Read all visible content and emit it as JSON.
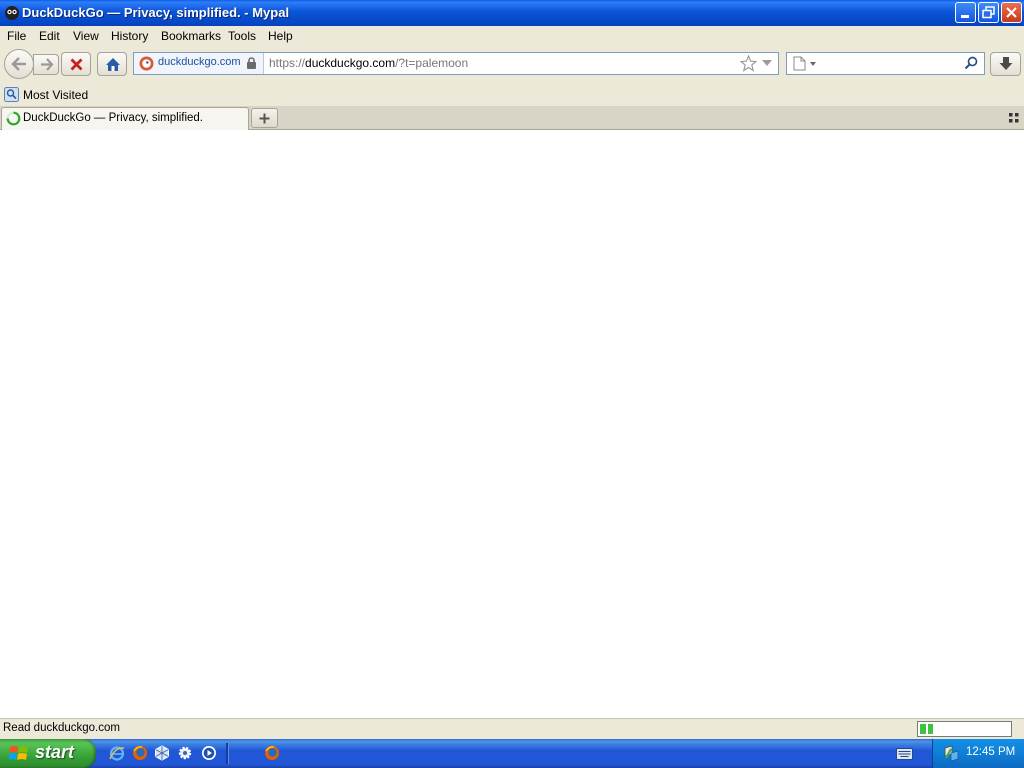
{
  "window": {
    "title": "DuckDuckGo — Privacy, simplified. - Mypal",
    "controls": [
      "minimize",
      "restore",
      "close"
    ]
  },
  "menubar": {
    "items": [
      "File",
      "Edit",
      "View",
      "History",
      "Bookmarks",
      "Tools",
      "Help"
    ]
  },
  "navbar": {
    "identity_label": "duckduckgo.com",
    "url_prefix": "https://",
    "url_host": "duckduckgo.com",
    "url_path": "/?t=palemoon",
    "search_placeholder": ""
  },
  "bookmarks": {
    "items": [
      "Most Visited"
    ]
  },
  "tabs": [
    {
      "label": "DuckDuckGo — Privacy, simplified.",
      "active": true,
      "loading": true
    }
  ],
  "status": {
    "text": "Read duckduckgo.com",
    "progress": 0.15
  },
  "taskbar": {
    "start_label": "start",
    "quick_launch": [
      "internet-explorer",
      "firefox",
      "virtualbox",
      "settings",
      "media-player"
    ],
    "running": [
      "mypal-browser"
    ],
    "clock": "12:45 PM"
  },
  "colors": {
    "titlebar": "#0a55d9",
    "chrome": "#ece9d8",
    "taskbar": "#2157d7",
    "start_button": "#37a137",
    "url_host_color": "#000000",
    "url_dim_color": "#777777",
    "identity_color": "#1b4fa0"
  }
}
